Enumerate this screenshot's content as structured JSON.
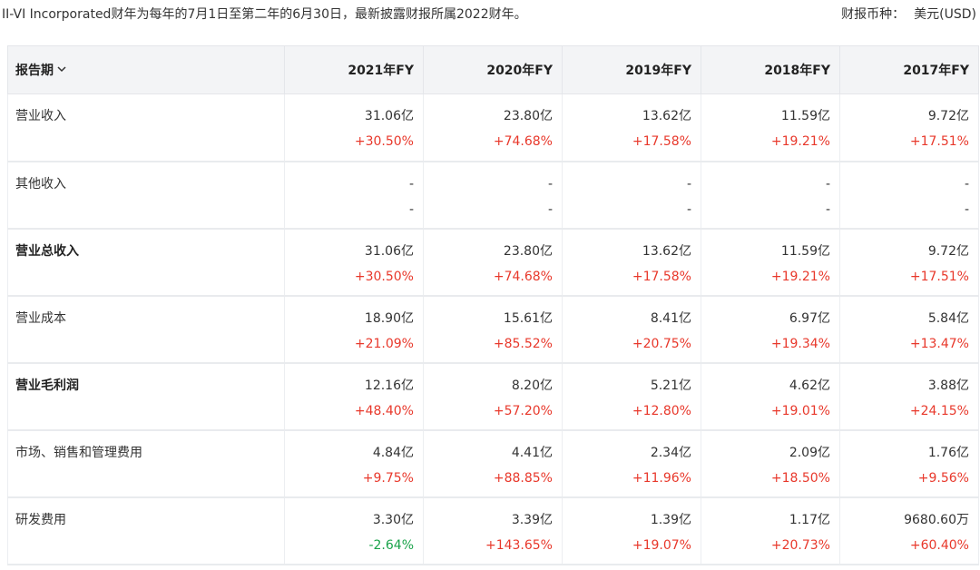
{
  "note": "II-VI Incorporated财年为每年的7月1日至第二年的6月30日，最新披露财报所属2022财年。",
  "currency_label": "财报币种：",
  "currency_value": "美元(USD)",
  "table": {
    "period_label": "报告期",
    "columns": [
      "2021年FY",
      "2020年FY",
      "2019年FY",
      "2018年FY",
      "2017年FY"
    ],
    "rows": [
      {
        "label": "营业收入",
        "bold": false,
        "values": [
          "31.06亿",
          "23.80亿",
          "13.62亿",
          "11.59亿",
          "9.72亿"
        ],
        "changes": [
          "+30.50%",
          "+74.68%",
          "+17.58%",
          "+19.21%",
          "+17.51%"
        ]
      },
      {
        "label": "其他收入",
        "bold": false,
        "values": [
          "-",
          "-",
          "-",
          "-",
          "-"
        ],
        "changes": [
          "-",
          "-",
          "-",
          "-",
          "-"
        ]
      },
      {
        "label": "营业总收入",
        "bold": true,
        "values": [
          "31.06亿",
          "23.80亿",
          "13.62亿",
          "11.59亿",
          "9.72亿"
        ],
        "changes": [
          "+30.50%",
          "+74.68%",
          "+17.58%",
          "+19.21%",
          "+17.51%"
        ]
      },
      {
        "label": "营业成本",
        "bold": false,
        "values": [
          "18.90亿",
          "15.61亿",
          "8.41亿",
          "6.97亿",
          "5.84亿"
        ],
        "changes": [
          "+21.09%",
          "+85.52%",
          "+20.75%",
          "+19.34%",
          "+13.47%"
        ]
      },
      {
        "label": "营业毛利润",
        "bold": true,
        "values": [
          "12.16亿",
          "8.20亿",
          "5.21亿",
          "4.62亿",
          "3.88亿"
        ],
        "changes": [
          "+48.40%",
          "+57.20%",
          "+12.80%",
          "+19.01%",
          "+24.15%"
        ]
      },
      {
        "label": "市场、销售和管理费用",
        "bold": false,
        "values": [
          "4.84亿",
          "4.41亿",
          "2.34亿",
          "2.09亿",
          "1.76亿"
        ],
        "changes": [
          "+9.75%",
          "+88.85%",
          "+11.96%",
          "+18.50%",
          "+9.56%"
        ]
      },
      {
        "label": "研发费用",
        "bold": false,
        "values": [
          "3.30亿",
          "3.39亿",
          "1.39亿",
          "1.17亿",
          "9680.60万"
        ],
        "changes": [
          "-2.64%",
          "+143.65%",
          "+19.07%",
          "+20.73%",
          "+60.40%"
        ]
      }
    ]
  },
  "colors": {
    "positive": "#e8382b",
    "negative": "#1aa34a",
    "header_bg": "#f3f4f6"
  },
  "icons": {
    "period_toggle": "chevron-down-icon"
  }
}
